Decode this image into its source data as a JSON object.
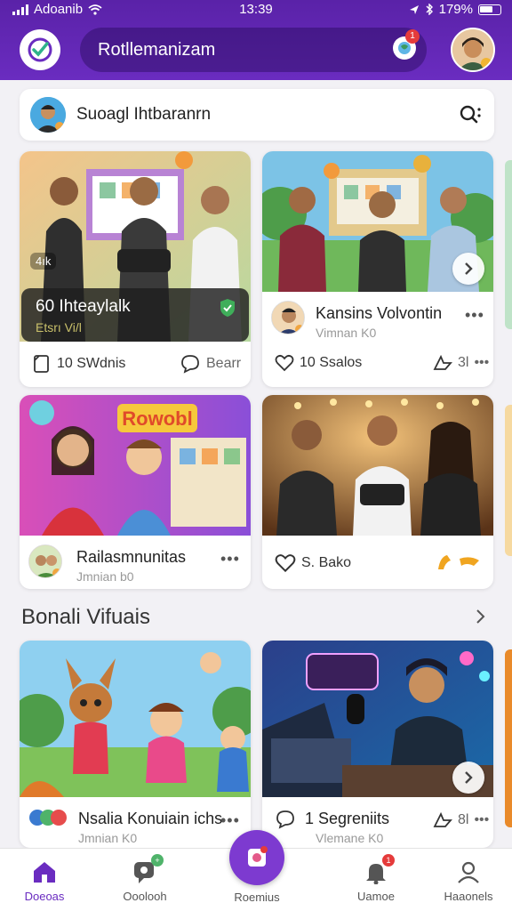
{
  "status_bar": {
    "carrier": "Adoanib",
    "time": "13:39",
    "battery": "179%"
  },
  "header": {
    "search_text": "Rotllemanizam",
    "notification_count": "1"
  },
  "suggestion": {
    "text": "Suoagl Ihtbaranrn"
  },
  "cards": [
    {
      "overlay_title": "60 Ihteaylalk",
      "overlay_sub": "Etsrı Vi/l",
      "tag": "4ık",
      "stat_left": "10 SWdnis",
      "stat_right": "Bearr"
    },
    {
      "title": "Kansins Volvontin",
      "sub": "Vimnan K0",
      "stat_left": "10 Ssalos",
      "stat_right": "3l"
    },
    {
      "thumb_title": "Rowobl",
      "title": "Railasmnunitas",
      "sub": "Jmnian b0"
    },
    {
      "stat_left": "S. Bako"
    },
    {
      "title": "Nsalia Konuiain ichs",
      "sub": "Jmnian K0"
    },
    {
      "title": "1 Segreniits",
      "sub": "Vlemane K0",
      "stat_right": "8l"
    }
  ],
  "section": {
    "title": "Bonali Vifuais"
  },
  "bottom_nav": {
    "items": [
      {
        "label": "Doeoas",
        "icon": "home-icon"
      },
      {
        "label": "Ooolooh",
        "icon": "chat-icon"
      },
      {
        "label": "Roemius",
        "icon": "create-icon"
      },
      {
        "label": "Uamoe",
        "icon": "bell-icon"
      },
      {
        "label": "Haaonels",
        "icon": "profile-icon"
      }
    ],
    "active": "Doeoas"
  },
  "colors": {
    "brand_purple": "#6a2cc0",
    "badge_red": "#e53b3b"
  }
}
